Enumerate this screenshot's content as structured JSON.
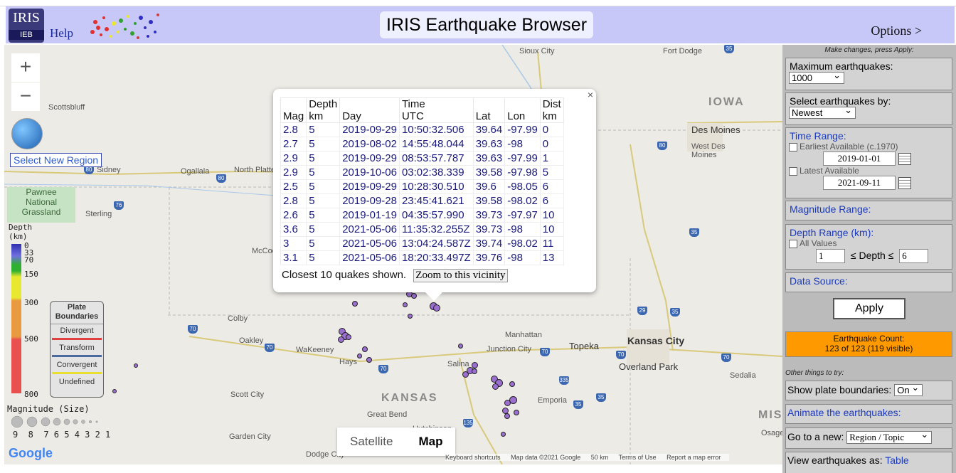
{
  "header": {
    "logo_line1": "IRIS",
    "logo_line2": "IEB",
    "help_label": "Help",
    "title": "IRIS Earthquake Browser",
    "options_label": "Options >"
  },
  "map": {
    "zoom_in": "+",
    "zoom_out": "−",
    "select_region_label": "Select New Region",
    "park_name": [
      "Pawnee",
      "National",
      "Grassland"
    ],
    "state_labels": {
      "iowa": "IOWA",
      "kansas": "KANSAS",
      "mis": "MIS"
    },
    "cities": {
      "sioux_city": "Sioux City",
      "fort_dodge": "Fort Dodge",
      "scottsbluff": "Scottsbluff",
      "des_moines": "Des Moines",
      "west_des_moines": [
        "West Des",
        "Moines"
      ],
      "sidney": "Sidney",
      "ogallala": "Ogallala",
      "north_platte": "North Platte",
      "sterling": "Sterling",
      "mccook": "McCoo",
      "colby": "Colby",
      "oakley": "Oakley",
      "wakeeney": "WaKeeney",
      "hays": "Hays",
      "manhattan": "Manhattan",
      "junction_city": "Junction City",
      "topeka": "Topeka",
      "kansas_city": "Kansas City",
      "overland_park": "Overland Park",
      "salina": "Salina",
      "sedalia": "Sedalia",
      "scott_city": "Scott City",
      "great_bend": "Great Bend",
      "emporia": "Emporia",
      "hutchinson": "Hutchinson",
      "garden_city": "Garden City",
      "dodge_city": "Dodge City",
      "osage": "Osage"
    },
    "map_type": {
      "satellite": "Satellite",
      "map": "Map"
    },
    "google_logo": "Google",
    "attribution": {
      "shortcuts": "Keyboard shortcuts",
      "data": "Map data ©2021 Google",
      "scale": "50 km",
      "terms": "Terms of Use",
      "report": "Report a map error"
    }
  },
  "depth_legend": {
    "title_line1": "Depth",
    "title_line2": "(km)",
    "ticks": [
      "0",
      "33",
      "70",
      "150",
      "300",
      "500",
      "800"
    ],
    "colors": [
      "#3030b0",
      "#7070e0",
      "#30b030",
      "#e8e830",
      "#e89a40",
      "#e85050"
    ]
  },
  "plate_legend": {
    "title_line1": "Plate",
    "title_line2": "Boundaries",
    "items": [
      {
        "label": "Divergent",
        "color": "#e04040"
      },
      {
        "label": "Transform",
        "color": "#4a6aa0"
      },
      {
        "label": "Convergent",
        "color": "#e8e030"
      },
      {
        "label": "Undefined",
        "color": "#e4e4e4"
      }
    ]
  },
  "mag_legend": {
    "title": "Magnitude (Size)",
    "numbers": "9  8  7 6 5 4 3 2 1"
  },
  "popup": {
    "headers": {
      "mag": "Mag",
      "depth": [
        "Depth",
        "km"
      ],
      "day": "Day",
      "time": [
        "Time",
        "UTC"
      ],
      "lat": "Lat",
      "lon": "Lon",
      "dist": [
        "Dist",
        "km"
      ]
    },
    "rows": [
      {
        "mag": "2.8",
        "depth": "5",
        "day": "2019-09-29",
        "time": "10:50:32.506",
        "lat": "39.64",
        "lon": "-97.99",
        "dist": "0"
      },
      {
        "mag": "2.7",
        "depth": "5",
        "day": "2019-08-02",
        "time": "14:55:48.044",
        "lat": "39.63",
        "lon": "-98",
        "dist": "0"
      },
      {
        "mag": "2.9",
        "depth": "5",
        "day": "2019-09-29",
        "time": "08:53:57.787",
        "lat": "39.63",
        "lon": "-97.99",
        "dist": "1"
      },
      {
        "mag": "2.9",
        "depth": "5",
        "day": "2019-10-06",
        "time": "03:02:38.339",
        "lat": "39.58",
        "lon": "-97.98",
        "dist": "5"
      },
      {
        "mag": "2.5",
        "depth": "5",
        "day": "2019-09-29",
        "time": "10:28:30.510",
        "lat": "39.6",
        "lon": "-98.05",
        "dist": "6"
      },
      {
        "mag": "2.8",
        "depth": "5",
        "day": "2019-09-28",
        "time": "23:45:41.621",
        "lat": "39.58",
        "lon": "-98.02",
        "dist": "6"
      },
      {
        "mag": "2.6",
        "depth": "5",
        "day": "2019-01-19",
        "time": "04:35:57.990",
        "lat": "39.73",
        "lon": "-97.97",
        "dist": "10"
      },
      {
        "mag": "3.6",
        "depth": "5",
        "day": "2021-05-06",
        "time": "11:35:32.255Z",
        "lat": "39.73",
        "lon": "-98",
        "dist": "10"
      },
      {
        "mag": "3",
        "depth": "5",
        "day": "2021-05-06",
        "time": "13:04:24.587Z",
        "lat": "39.74",
        "lon": "-98.02",
        "dist": "11"
      },
      {
        "mag": "3.1",
        "depth": "5",
        "day": "2021-05-06",
        "time": "18:20:33.497Z",
        "lat": "39.76",
        "lon": "-98",
        "dist": "13"
      }
    ],
    "footer_text": "Closest 10 quakes shown.",
    "zoom_button": "Zoom to this vicinity",
    "close": "×"
  },
  "panel": {
    "hint": "Make changes, press Apply:",
    "max_label": "Maximum earthquakes:",
    "max_value": "1000",
    "select_by_label": "Select earthquakes by:",
    "select_by_value": "Newest",
    "time_range_label": "Time Range:",
    "earliest_label": "Earliest Available (c.1970)",
    "start_date": "2019-01-01",
    "latest_label": "Latest Available",
    "end_date": "2021-09-11",
    "magnitude_label": "Magnitude Range:",
    "depth_label": "Depth Range (km):",
    "all_values_label": "All Values",
    "depth_min": "1",
    "depth_op": "≤ Depth ≤",
    "depth_max": "6",
    "data_source_label": "Data Source:",
    "apply_label": "Apply",
    "count_line1": "Earthquake Count:",
    "count_line2": "123 of 123 (119 visible)",
    "other_label": "Other things to try:",
    "plate_label": "Show plate boundaries:",
    "plate_value": "On",
    "animate_label": "Animate the earthquakes:",
    "goto_label": "Go to a new:",
    "goto_value": "Region / Topic",
    "view_label": "View earthquakes as:",
    "view_value": "Table"
  }
}
